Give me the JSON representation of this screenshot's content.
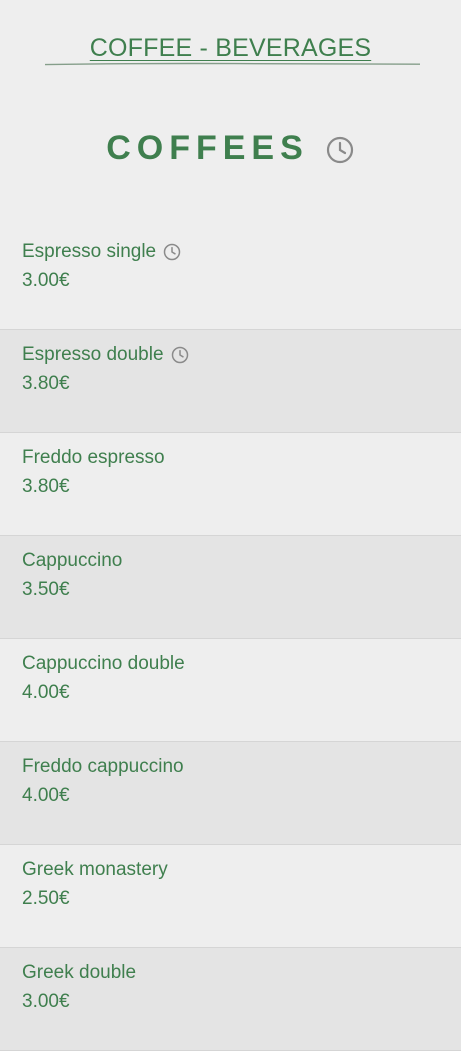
{
  "header": {
    "category_title": "COFFEE - BEVERAGES"
  },
  "section": {
    "title": "COFFEES",
    "icon": "clock-icon"
  },
  "colors": {
    "accent": "#3f7f4e",
    "background": "#eeeeee",
    "row_alt": "#e4e4e4",
    "icon_gray": "#8a8a8a"
  },
  "items": [
    {
      "name": "Espresso single",
      "price": "3.00€",
      "has_clock": true
    },
    {
      "name": "Espresso double",
      "price": "3.80€",
      "has_clock": true
    },
    {
      "name": "Freddo espresso",
      "price": "3.80€",
      "has_clock": false
    },
    {
      "name": "Cappuccino",
      "price": "3.50€",
      "has_clock": false
    },
    {
      "name": "Cappuccino double",
      "price": "4.00€",
      "has_clock": false
    },
    {
      "name": "Freddo cappuccino",
      "price": "4.00€",
      "has_clock": false
    },
    {
      "name": "Greek monastery",
      "price": "2.50€",
      "has_clock": false
    },
    {
      "name": "Greek double",
      "price": "3.00€",
      "has_clock": false
    }
  ]
}
